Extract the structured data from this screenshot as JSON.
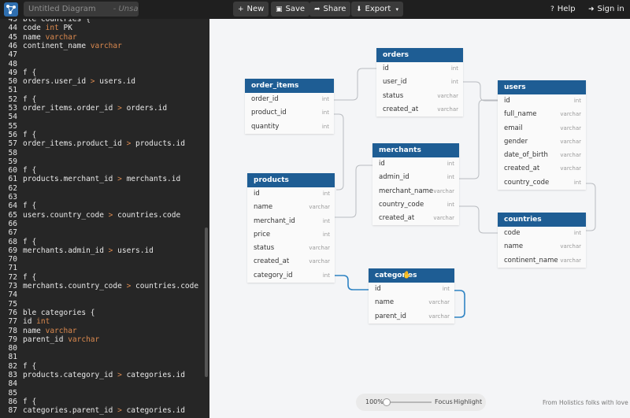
{
  "header": {
    "title_placeholder": "Untitled Diagram",
    "unsaved": "- Unsaved",
    "new_label": "New",
    "save_label": "Save",
    "share_label": "Share",
    "export_label": "Export",
    "help_label": "Help",
    "signin_label": "Sign in"
  },
  "editor": {
    "lines": [
      {
        "n": "43",
        "parts": [
          {
            "t": "ble countries {"
          }
        ]
      },
      {
        "n": "44",
        "parts": [
          {
            "t": "code "
          },
          {
            "t": "int",
            "c": "kw"
          },
          {
            "t": " PK"
          }
        ]
      },
      {
        "n": "45",
        "parts": [
          {
            "t": "name "
          },
          {
            "t": "varchar",
            "c": "kw"
          }
        ]
      },
      {
        "n": "46",
        "parts": [
          {
            "t": "continent_name "
          },
          {
            "t": "varchar",
            "c": "kw"
          }
        ]
      },
      {
        "n": "47",
        "parts": []
      },
      {
        "n": "48",
        "parts": []
      },
      {
        "n": "49",
        "parts": [
          {
            "t": "f {"
          }
        ]
      },
      {
        "n": "50",
        "parts": [
          {
            "t": "orders.user_id "
          },
          {
            "t": ">",
            "c": "op"
          },
          {
            "t": " users.id"
          }
        ]
      },
      {
        "n": "51",
        "parts": []
      },
      {
        "n": "52",
        "parts": [
          {
            "t": "f {"
          }
        ]
      },
      {
        "n": "53",
        "parts": [
          {
            "t": "order_items.order_id "
          },
          {
            "t": ">",
            "c": "op"
          },
          {
            "t": " orders.id"
          }
        ]
      },
      {
        "n": "54",
        "parts": []
      },
      {
        "n": "55",
        "parts": []
      },
      {
        "n": "56",
        "parts": [
          {
            "t": "f {"
          }
        ]
      },
      {
        "n": "57",
        "parts": [
          {
            "t": "order_items.product_id "
          },
          {
            "t": ">",
            "c": "op"
          },
          {
            "t": " products.id"
          }
        ]
      },
      {
        "n": "58",
        "parts": []
      },
      {
        "n": "59",
        "parts": []
      },
      {
        "n": "60",
        "parts": [
          {
            "t": "f {"
          }
        ]
      },
      {
        "n": "61",
        "parts": [
          {
            "t": "products.merchant_id "
          },
          {
            "t": ">",
            "c": "op"
          },
          {
            "t": " merchants.id"
          }
        ]
      },
      {
        "n": "62",
        "parts": []
      },
      {
        "n": "63",
        "parts": []
      },
      {
        "n": "64",
        "parts": [
          {
            "t": "f {"
          }
        ]
      },
      {
        "n": "65",
        "parts": [
          {
            "t": "users.country_code "
          },
          {
            "t": ">",
            "c": "op"
          },
          {
            "t": " countries.code"
          }
        ]
      },
      {
        "n": "66",
        "parts": []
      },
      {
        "n": "67",
        "parts": []
      },
      {
        "n": "68",
        "parts": [
          {
            "t": "f {"
          }
        ]
      },
      {
        "n": "69",
        "parts": [
          {
            "t": "merchants.admin_id "
          },
          {
            "t": ">",
            "c": "op"
          },
          {
            "t": " users.id"
          }
        ]
      },
      {
        "n": "70",
        "parts": []
      },
      {
        "n": "71",
        "parts": []
      },
      {
        "n": "72",
        "parts": [
          {
            "t": "f {"
          }
        ]
      },
      {
        "n": "73",
        "parts": [
          {
            "t": "merchants.country_code "
          },
          {
            "t": ">",
            "c": "op"
          },
          {
            "t": " countries.code"
          }
        ]
      },
      {
        "n": "74",
        "parts": []
      },
      {
        "n": "75",
        "parts": []
      },
      {
        "n": "76",
        "parts": [
          {
            "t": "ble categories {"
          }
        ]
      },
      {
        "n": "77",
        "parts": [
          {
            "t": "id "
          },
          {
            "t": "int",
            "c": "kw"
          }
        ]
      },
      {
        "n": "78",
        "parts": [
          {
            "t": "name "
          },
          {
            "t": "varchar",
            "c": "kw"
          }
        ]
      },
      {
        "n": "79",
        "parts": [
          {
            "t": "parent_id "
          },
          {
            "t": "varchar",
            "c": "kw"
          }
        ]
      },
      {
        "n": "80",
        "parts": []
      },
      {
        "n": "81",
        "parts": []
      },
      {
        "n": "82",
        "parts": [
          {
            "t": "f {"
          }
        ]
      },
      {
        "n": "83",
        "parts": [
          {
            "t": "products.category_id "
          },
          {
            "t": ">",
            "c": "op"
          },
          {
            "t": " categories.id"
          }
        ]
      },
      {
        "n": "84",
        "parts": []
      },
      {
        "n": "85",
        "parts": []
      },
      {
        "n": "86",
        "parts": [
          {
            "t": "f {"
          }
        ]
      },
      {
        "n": "87",
        "parts": [
          {
            "t": "categories.parent_id "
          },
          {
            "t": ">",
            "c": "op"
          },
          {
            "t": " categories.id"
          }
        ]
      }
    ]
  },
  "tables": [
    {
      "id": "order_items",
      "name": "order_items",
      "rows": [
        {
          "name": "order_id",
          "type": "int"
        },
        {
          "name": "product_id",
          "type": "int"
        },
        {
          "name": "quantity",
          "type": "int"
        }
      ]
    },
    {
      "id": "orders",
      "name": "orders",
      "rows": [
        {
          "name": "id",
          "type": "int"
        },
        {
          "name": "user_id",
          "type": "int"
        },
        {
          "name": "status",
          "type": "varchar"
        },
        {
          "name": "created_at",
          "type": "varchar"
        }
      ]
    },
    {
      "id": "users",
      "name": "users",
      "rows": [
        {
          "name": "id",
          "type": "int"
        },
        {
          "name": "full_name",
          "type": "varchar"
        },
        {
          "name": "email",
          "type": "varchar"
        },
        {
          "name": "gender",
          "type": "varchar"
        },
        {
          "name": "date_of_birth",
          "type": "varchar"
        },
        {
          "name": "created_at",
          "type": "varchar"
        },
        {
          "name": "country_code",
          "type": "int"
        }
      ]
    },
    {
      "id": "merchants",
      "name": "merchants",
      "rows": [
        {
          "name": "id",
          "type": "int"
        },
        {
          "name": "admin_id",
          "type": "int"
        },
        {
          "name": "merchant_name",
          "type": "varchar"
        },
        {
          "name": "country_code",
          "type": "int"
        },
        {
          "name": "created_at",
          "type": "varchar"
        }
      ]
    },
    {
      "id": "products",
      "name": "products",
      "rows": [
        {
          "name": "id",
          "type": "int"
        },
        {
          "name": "name",
          "type": "varchar"
        },
        {
          "name": "merchant_id",
          "type": "int"
        },
        {
          "name": "price",
          "type": "int"
        },
        {
          "name": "status",
          "type": "varchar"
        },
        {
          "name": "created_at",
          "type": "varchar"
        },
        {
          "name": "category_id",
          "type": "int"
        }
      ]
    },
    {
      "id": "countries",
      "name": "countries",
      "rows": [
        {
          "name": "code",
          "type": "int"
        },
        {
          "name": "name",
          "type": "varchar"
        },
        {
          "name": "continent_name",
          "type": "varchar"
        }
      ]
    },
    {
      "id": "categories",
      "name": "categories",
      "rows": [
        {
          "name": "id",
          "type": "int"
        },
        {
          "name": "name",
          "type": "varchar"
        },
        {
          "name": "parent_id",
          "type": "varchar"
        }
      ]
    }
  ],
  "zoom": {
    "level": "100%",
    "focus_label": "Focus",
    "highlight_label": "Highlight"
  },
  "footer": {
    "note": "From Holistics folks with love"
  },
  "colors": {
    "table_header": "#1e5d94",
    "link_line": "#b9bcc0",
    "link_highlight": "#2f84c4",
    "keyword": "#dc8a4f"
  }
}
